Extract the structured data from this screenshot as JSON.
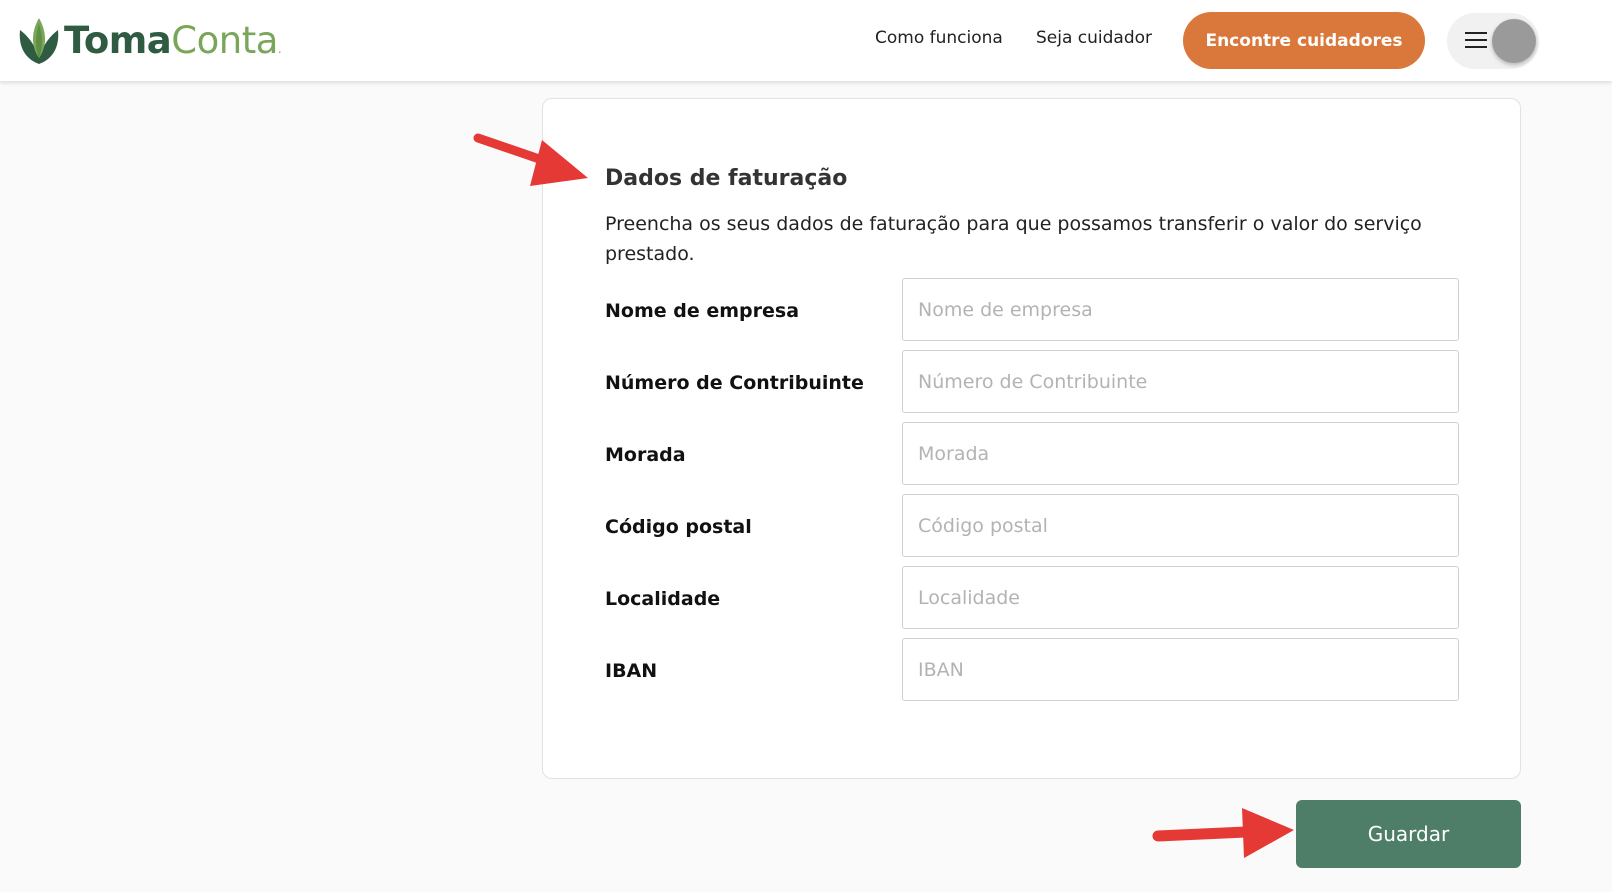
{
  "header": {
    "logo": {
      "part1": "Toma",
      "part2": "Conta",
      "mark": "."
    },
    "nav": {
      "how_it_works": "Como funciona",
      "become_carer": "Seja cuidador"
    },
    "cta_label": "Encontre cuidadores",
    "menu_icon": "hamburger-icon",
    "avatar_icon": "user-avatar"
  },
  "billing": {
    "title": "Dados de faturação",
    "description": "Preencha os seus dados de faturação para que possamos transferir o valor do serviço prestado.",
    "fields": [
      {
        "label": "Nome de empresa",
        "placeholder": "Nome de empresa",
        "value": ""
      },
      {
        "label": "Número de Contribuinte",
        "placeholder": "Número de Contribuinte",
        "value": ""
      },
      {
        "label": "Morada",
        "placeholder": "Morada",
        "value": ""
      },
      {
        "label": "Código postal",
        "placeholder": "Código postal",
        "value": ""
      },
      {
        "label": "Localidade",
        "placeholder": "Localidade",
        "value": ""
      },
      {
        "label": "IBAN",
        "placeholder": "IBAN",
        "value": ""
      }
    ]
  },
  "actions": {
    "save_label": "Guardar"
  },
  "colors": {
    "brand_dark": "#2f5b43",
    "brand_light": "#7aa65a",
    "cta": "#d9783a",
    "save_button": "#4e7e67",
    "annotation_arrow": "#e53935"
  }
}
